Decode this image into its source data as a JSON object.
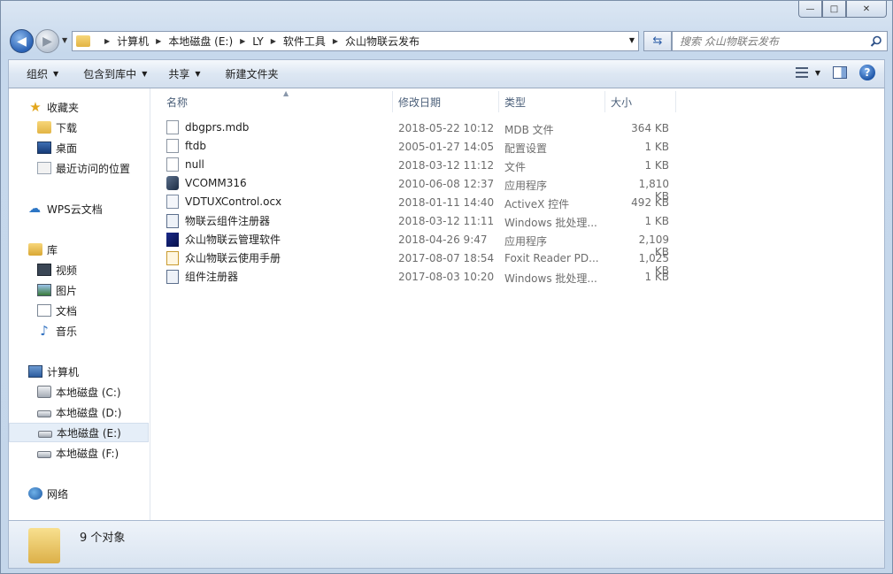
{
  "window": {
    "caption_buttons": [
      "—",
      "□",
      "✕"
    ]
  },
  "address": {
    "breadcrumbs": [
      "计算机",
      "本地磁盘 (E:)",
      "LY",
      "软件工具",
      "众山物联云发布"
    ]
  },
  "search": {
    "placeholder": "搜索 众山物联云发布"
  },
  "toolbar": {
    "organize": "组织",
    "include_in_library": "包含到库中",
    "share": "共享",
    "new_folder": "新建文件夹"
  },
  "sidebar": {
    "favorites": "收藏夹",
    "downloads": "下载",
    "desktop": "桌面",
    "recent": "最近访问的位置",
    "wps_cloud": "WPS云文档",
    "libraries": "库",
    "videos": "视频",
    "pictures": "图片",
    "documents": "文档",
    "music": "音乐",
    "computer": "计算机",
    "drive_c": "本地磁盘 (C:)",
    "drive_d": "本地磁盘 (D:)",
    "drive_e": "本地磁盘 (E:)",
    "drive_f": "本地磁盘 (F:)",
    "network": "网络"
  },
  "columns": {
    "name": "名称",
    "date": "修改日期",
    "type": "类型",
    "size": "大小"
  },
  "files": [
    {
      "name": "dbgprs.mdb",
      "date": "2018-05-22 10:12",
      "type": "MDB 文件",
      "size": "364 KB",
      "icon": "file-icon"
    },
    {
      "name": "ftdb",
      "date": "2005-01-27 14:05",
      "type": "配置设置",
      "size": "1 KB",
      "icon": "settings-file-icon"
    },
    {
      "name": "null",
      "date": "2018-03-12 11:12",
      "type": "文件",
      "size": "1 KB",
      "icon": "file-icon"
    },
    {
      "name": "VCOMM316",
      "date": "2010-06-08 12:37",
      "type": "应用程序",
      "size": "1,810 KB",
      "icon": "application-icon"
    },
    {
      "name": "VDTUXControl.ocx",
      "date": "2018-01-11 14:40",
      "type": "ActiveX 控件",
      "size": "492 KB",
      "icon": "activex-icon"
    },
    {
      "name": "物联云组件注册器",
      "date": "2018-03-12 11:11",
      "type": "Windows 批处理...",
      "size": "1 KB",
      "icon": "batch-file-icon"
    },
    {
      "name": "众山物联云管理软件",
      "date": "2018-04-26 9:47",
      "type": "应用程序",
      "size": "2,109 KB",
      "icon": "application-icon"
    },
    {
      "name": "众山物联云使用手册",
      "date": "2017-08-07 18:54",
      "type": "Foxit Reader PD...",
      "size": "1,025 KB",
      "icon": "pdf-icon"
    },
    {
      "name": "组件注册器",
      "date": "2017-08-03 10:20",
      "type": "Windows 批处理...",
      "size": "1 KB",
      "icon": "batch-file-icon"
    }
  ],
  "status": {
    "count": "9 个对象"
  }
}
